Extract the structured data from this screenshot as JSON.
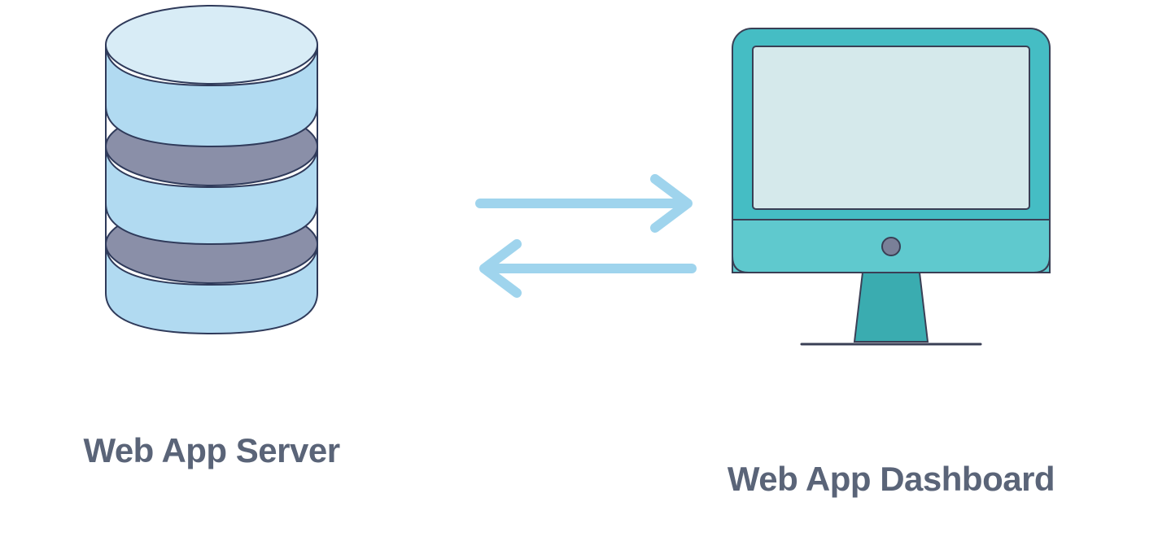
{
  "nodes": {
    "server": {
      "label": "Web App Server"
    },
    "dashboard": {
      "label": "Web App Dashboard"
    }
  },
  "arrows": {
    "direction": "bidirectional"
  },
  "colors": {
    "labelText": "#5a6478",
    "dbFill": "#b1daf1",
    "dbTopFill": "#d8ecf6",
    "dbShadow": "#8a8fa8",
    "dbStroke": "#2f3a5a",
    "arrow": "#9fd4ed",
    "monitorFrame": "#45bdc4",
    "monitorScreen": "#d5e9eb",
    "monitorBase": "#5fc9ce",
    "monitorStroke": "#3a3f55",
    "monitorStand": "#3aacb0"
  }
}
